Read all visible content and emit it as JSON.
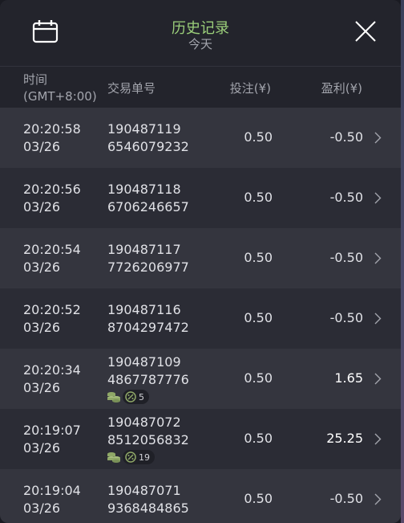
{
  "header": {
    "title": "历史记录",
    "subtitle": "今天"
  },
  "columns": {
    "time_line1": "时间",
    "time_line2": "(GMT+8:00)",
    "order": "交易单号",
    "bet": "投注(¥)",
    "profit": "盈利(¥)"
  },
  "colors": {
    "accent": "#9bcf7a",
    "text": "#e0e1e6",
    "muted": "#a3a5ad",
    "icon": "#8fa867"
  },
  "icons": {
    "header_left": "calendar-icon",
    "header_right": "close-icon",
    "row": "chevron-right-icon",
    "badge_1": "coin-stack-icon",
    "badge_2": "dice-icon"
  },
  "rows": [
    {
      "time": "20:20:58",
      "date": "03/26",
      "order1": "190487119",
      "order2": "6546079232",
      "bet": "0.50",
      "profit": "-0.50"
    },
    {
      "time": "20:20:56",
      "date": "03/26",
      "order1": "190487118",
      "order2": "6706246657",
      "bet": "0.50",
      "profit": "-0.50"
    },
    {
      "time": "20:20:54",
      "date": "03/26",
      "order1": "190487117",
      "order2": "7726206977",
      "bet": "0.50",
      "profit": "-0.50"
    },
    {
      "time": "20:20:52",
      "date": "03/26",
      "order1": "190487116",
      "order2": "8704297472",
      "bet": "0.50",
      "profit": "-0.50"
    },
    {
      "time": "20:20:34",
      "date": "03/26",
      "order1": "190487109",
      "order2": "4867787776",
      "bet": "0.50",
      "profit": "1.65",
      "badge_count": "5"
    },
    {
      "time": "20:19:07",
      "date": "03/26",
      "order1": "190487072",
      "order2": "8512056832",
      "bet": "0.50",
      "profit": "25.25",
      "badge_count": "19"
    },
    {
      "time": "20:19:04",
      "date": "03/26",
      "order1": "190487071",
      "order2": "9368484865",
      "bet": "0.50",
      "profit": "-0.50"
    }
  ]
}
